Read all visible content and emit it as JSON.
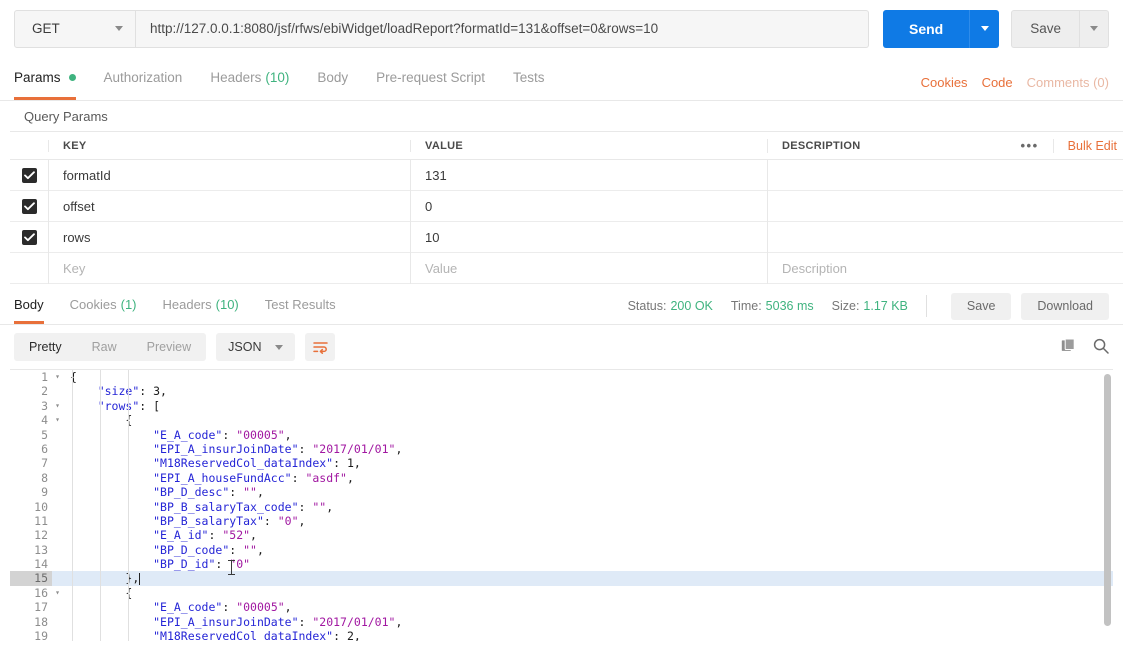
{
  "request": {
    "method": "GET",
    "url": "http://127.0.0.1:8080/jsf/rfws/ebiWidget/loadReport?formatId=131&offset=0&rows=10",
    "send_label": "Send",
    "save_label": "Save"
  },
  "request_tabs": [
    {
      "label": "Params",
      "badge_dot": true,
      "active": true
    },
    {
      "label": "Authorization",
      "active": false
    },
    {
      "label": "Headers",
      "count": "(10)",
      "active": false
    },
    {
      "label": "Body",
      "active": false
    },
    {
      "label": "Pre-request Script",
      "active": false
    },
    {
      "label": "Tests",
      "active": false
    }
  ],
  "tabs_right": {
    "cookies": "Cookies",
    "code": "Code",
    "comments": "Comments (0)"
  },
  "query_params": {
    "title": "Query Params",
    "columns": {
      "key": "KEY",
      "value": "VALUE",
      "description": "DESCRIPTION"
    },
    "more_icon": "•••",
    "bulk_edit": "Bulk Edit",
    "rows": [
      {
        "checked": true,
        "key": "formatId",
        "value": "131",
        "description": ""
      },
      {
        "checked": true,
        "key": "offset",
        "value": "0",
        "description": ""
      },
      {
        "checked": true,
        "key": "rows",
        "value": "10",
        "description": ""
      }
    ],
    "placeholder_row": {
      "key": "Key",
      "value": "Value",
      "description": "Description"
    }
  },
  "response_tabs": [
    {
      "label": "Body",
      "active": true
    },
    {
      "label": "Cookies",
      "count": "(1)",
      "active": false
    },
    {
      "label": "Headers",
      "count": "(10)",
      "active": false
    },
    {
      "label": "Test Results",
      "active": false
    }
  ],
  "response_meta": {
    "status_label": "Status:",
    "status_value": "200 OK",
    "time_label": "Time:",
    "time_value": "5036 ms",
    "size_label": "Size:",
    "size_value": "1.17 KB",
    "save_label": "Save",
    "download_label": "Download"
  },
  "body_toolbar": {
    "views": [
      {
        "label": "Pretty",
        "active": true
      },
      {
        "label": "Raw",
        "active": false
      },
      {
        "label": "Preview",
        "active": false
      }
    ],
    "format": "JSON",
    "wrap_icon": "wrap-lines-icon",
    "copy_icon": "copy-icon",
    "search_icon": "search-icon"
  },
  "colors": {
    "accent_orange": "#e8703a",
    "send_blue": "#0f7ae5",
    "status_green": "#3fb37f",
    "json_key": "#2525d6",
    "json_string": "#a117a1",
    "highlight_row": "#dfeaf7"
  },
  "json_body": {
    "active_line": 15,
    "lines": [
      {
        "n": 1,
        "fold": true,
        "indent": 0,
        "tokens": [
          {
            "t": "p",
            "v": "{"
          }
        ]
      },
      {
        "n": 2,
        "fold": false,
        "indent": 1,
        "tokens": [
          {
            "t": "k",
            "v": "\"size\""
          },
          {
            "t": "p",
            "v": ": "
          },
          {
            "t": "n",
            "v": "3,"
          }
        ]
      },
      {
        "n": 3,
        "fold": true,
        "indent": 1,
        "tokens": [
          {
            "t": "k",
            "v": "\"rows\""
          },
          {
            "t": "p",
            "v": ": ["
          }
        ]
      },
      {
        "n": 4,
        "fold": true,
        "indent": 2,
        "tokens": [
          {
            "t": "p",
            "v": "{"
          }
        ]
      },
      {
        "n": 5,
        "fold": false,
        "indent": 3,
        "tokens": [
          {
            "t": "k",
            "v": "\"E_A_code\""
          },
          {
            "t": "p",
            "v": ": "
          },
          {
            "t": "s",
            "v": "\"00005\""
          },
          {
            "t": "p",
            "v": ","
          }
        ]
      },
      {
        "n": 6,
        "fold": false,
        "indent": 3,
        "tokens": [
          {
            "t": "k",
            "v": "\"EPI_A_insurJoinDate\""
          },
          {
            "t": "p",
            "v": ": "
          },
          {
            "t": "s",
            "v": "\"2017/01/01\""
          },
          {
            "t": "p",
            "v": ","
          }
        ]
      },
      {
        "n": 7,
        "fold": false,
        "indent": 3,
        "tokens": [
          {
            "t": "k",
            "v": "\"M18ReservedCol_dataIndex\""
          },
          {
            "t": "p",
            "v": ": "
          },
          {
            "t": "n",
            "v": "1,"
          }
        ]
      },
      {
        "n": 8,
        "fold": false,
        "indent": 3,
        "tokens": [
          {
            "t": "k",
            "v": "\"EPI_A_houseFundAcc\""
          },
          {
            "t": "p",
            "v": ": "
          },
          {
            "t": "s",
            "v": "\"asdf\""
          },
          {
            "t": "p",
            "v": ","
          }
        ]
      },
      {
        "n": 9,
        "fold": false,
        "indent": 3,
        "tokens": [
          {
            "t": "k",
            "v": "\"BP_D_desc\""
          },
          {
            "t": "p",
            "v": ": "
          },
          {
            "t": "s",
            "v": "\"\""
          },
          {
            "t": "p",
            "v": ","
          }
        ]
      },
      {
        "n": 10,
        "fold": false,
        "indent": 3,
        "tokens": [
          {
            "t": "k",
            "v": "\"BP_B_salaryTax_code\""
          },
          {
            "t": "p",
            "v": ": "
          },
          {
            "t": "s",
            "v": "\"\""
          },
          {
            "t": "p",
            "v": ","
          }
        ]
      },
      {
        "n": 11,
        "fold": false,
        "indent": 3,
        "tokens": [
          {
            "t": "k",
            "v": "\"BP_B_salaryTax\""
          },
          {
            "t": "p",
            "v": ": "
          },
          {
            "t": "s",
            "v": "\"0\""
          },
          {
            "t": "p",
            "v": ","
          }
        ]
      },
      {
        "n": 12,
        "fold": false,
        "indent": 3,
        "tokens": [
          {
            "t": "k",
            "v": "\"E_A_id\""
          },
          {
            "t": "p",
            "v": ": "
          },
          {
            "t": "s",
            "v": "\"52\""
          },
          {
            "t": "p",
            "v": ","
          }
        ]
      },
      {
        "n": 13,
        "fold": false,
        "indent": 3,
        "tokens": [
          {
            "t": "k",
            "v": "\"BP_D_code\""
          },
          {
            "t": "p",
            "v": ": "
          },
          {
            "t": "s",
            "v": "\"\""
          },
          {
            "t": "p",
            "v": ","
          }
        ]
      },
      {
        "n": 14,
        "fold": false,
        "indent": 3,
        "tokens": [
          {
            "t": "k",
            "v": "\"BP_D_id\""
          },
          {
            "t": "p",
            "v": ": "
          },
          {
            "t": "s",
            "v": "\"0\""
          }
        ]
      },
      {
        "n": 15,
        "fold": false,
        "indent": 2,
        "tokens": [
          {
            "t": "p",
            "v": "},"
          }
        ]
      },
      {
        "n": 16,
        "fold": true,
        "indent": 2,
        "tokens": [
          {
            "t": "p",
            "v": "{"
          }
        ]
      },
      {
        "n": 17,
        "fold": false,
        "indent": 3,
        "tokens": [
          {
            "t": "k",
            "v": "\"E_A_code\""
          },
          {
            "t": "p",
            "v": ": "
          },
          {
            "t": "s",
            "v": "\"00005\""
          },
          {
            "t": "p",
            "v": ","
          }
        ]
      },
      {
        "n": 18,
        "fold": false,
        "indent": 3,
        "tokens": [
          {
            "t": "k",
            "v": "\"EPI_A_insurJoinDate\""
          },
          {
            "t": "p",
            "v": ": "
          },
          {
            "t": "s",
            "v": "\"2017/01/01\""
          },
          {
            "t": "p",
            "v": ","
          }
        ]
      },
      {
        "n": 19,
        "fold": false,
        "indent": 3,
        "tokens": [
          {
            "t": "k",
            "v": "\"M18ReservedCol_dataIndex\""
          },
          {
            "t": "p",
            "v": ": "
          },
          {
            "t": "n",
            "v": "2,"
          }
        ]
      }
    ]
  }
}
